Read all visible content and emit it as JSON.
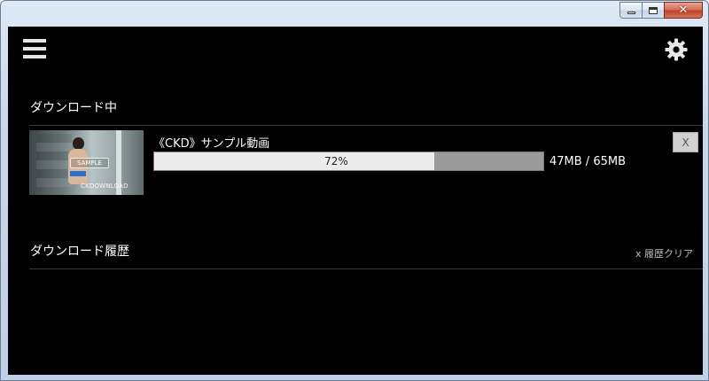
{
  "window": {
    "controls": {
      "minimize": "minimize-icon",
      "maximize": "maximize-icon",
      "close": "close-icon",
      "close_glyph": "✕"
    }
  },
  "toolbar": {
    "menu_icon": "hamburger-menu-icon",
    "settings_icon": "gear-icon"
  },
  "downloading": {
    "heading": "ダウンロード中",
    "items": [
      {
        "title": "《CKD》サンプル動画",
        "progress_percent": 72,
        "progress_label": "72%",
        "size_label": "47MB / 65MB",
        "cancel_label": "X",
        "thumbnail": {
          "watermark": "SAMPLE",
          "site_text": "CKDOWNLOAD"
        }
      }
    ]
  },
  "history": {
    "heading": "ダウンロード履歴",
    "clear_label": "x 履歴クリア"
  },
  "colors": {
    "content_bg": "#000000",
    "progress_fill": "#ececec",
    "progress_track": "#9a9a9a",
    "close_button": "#c0432b"
  }
}
